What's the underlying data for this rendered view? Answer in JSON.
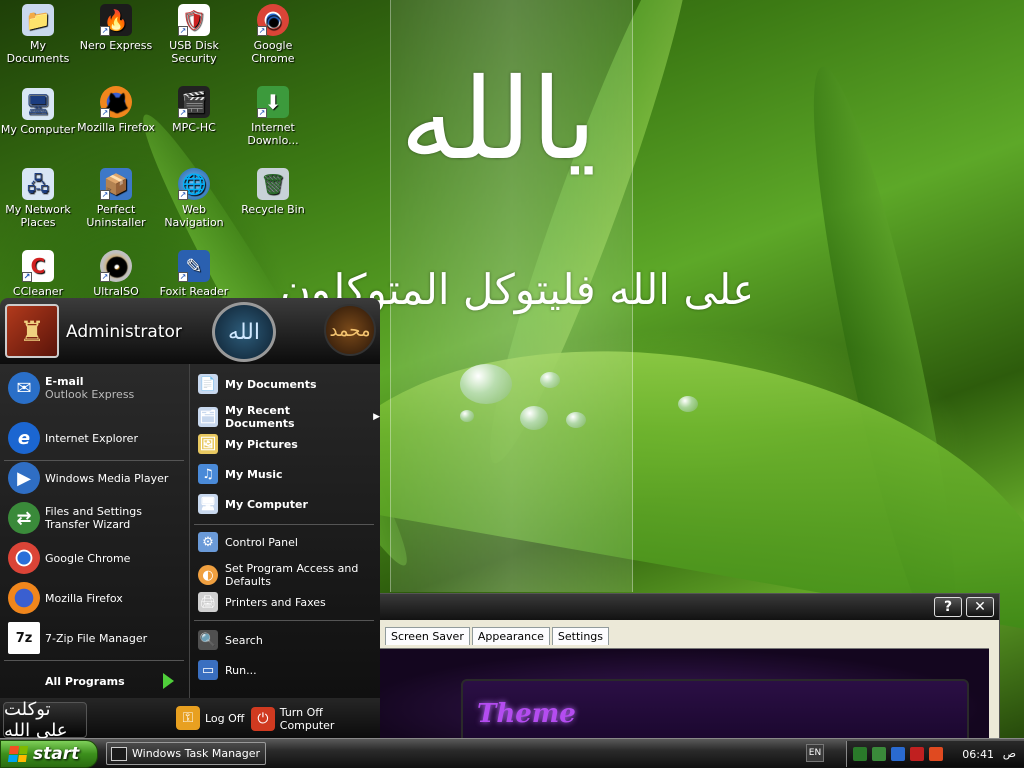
{
  "desktop": {
    "icons": [
      {
        "label": "My Documents",
        "glyph": "📁"
      },
      {
        "label": "Nero Express",
        "glyph": "🔥"
      },
      {
        "label": "USB Disk Security",
        "glyph": "🛡"
      },
      {
        "label": "Google Chrome",
        "glyph": "◉"
      },
      {
        "label": "My Computer",
        "glyph": "🖥"
      },
      {
        "label": "Mozilla Firefox",
        "glyph": "🦊"
      },
      {
        "label": "MPC-HC",
        "glyph": "🎬"
      },
      {
        "label": "Internet Downlo...",
        "glyph": "⬇"
      },
      {
        "label": "My Network Places",
        "glyph": "🖧"
      },
      {
        "label": "Perfect Uninstaller",
        "glyph": "📦"
      },
      {
        "label": "Web Navigation",
        "glyph": "🌐"
      },
      {
        "label": "Recycle Bin",
        "glyph": "🗑"
      },
      {
        "label": "CCleaner",
        "glyph": "C"
      },
      {
        "label": "UltraISO",
        "glyph": "💿"
      },
      {
        "label": "Foxit Reader",
        "glyph": "✎"
      }
    ]
  },
  "wallpaper": {
    "line1": "يالله",
    "line2": "وعلى الله فليتوكل المتوكلون"
  },
  "dialog": {
    "tabs": [
      "Screen Saver",
      "Appearance",
      "Settings"
    ],
    "help_label": "?",
    "close_label": "✕",
    "preview_text": "Theme"
  },
  "start_menu": {
    "username": "Administrator",
    "medallion": "الله",
    "medallion2": "محمد",
    "pinned": [
      {
        "title": "E-mail",
        "subtitle": "Outlook Express",
        "glyph": "✉",
        "color": "#2a6fc8"
      },
      {
        "title": "Internet Explorer",
        "glyph": "e",
        "color": "#1b66d1"
      }
    ],
    "recent": [
      {
        "title": "Windows Media Player",
        "glyph": "▶",
        "color": "#2f6ec4"
      },
      {
        "title": "Files and Settings Transfer Wizard",
        "glyph": "⇄",
        "color": "#3a8a3a"
      },
      {
        "title": "Google Chrome",
        "glyph": "◉",
        "color": "#d64032"
      },
      {
        "title": "Mozilla Firefox",
        "glyph": "🦊",
        "color": "#e06a18"
      },
      {
        "title": "7-Zip File Manager",
        "glyph": "7z",
        "color": "#111111"
      }
    ],
    "all_programs": "All Programs",
    "right_bold": [
      {
        "title": "My Documents",
        "glyph": "📄"
      },
      {
        "title": "My Recent Documents",
        "glyph": "🗂",
        "submenu": true
      },
      {
        "title": "My Pictures",
        "glyph": "🖼"
      },
      {
        "title": "My Music",
        "glyph": "♫"
      },
      {
        "title": "My Computer",
        "glyph": "🖥"
      }
    ],
    "right_plain": [
      {
        "title": "Control Panel",
        "glyph": "⚙"
      },
      {
        "title": "Set Program Access and Defaults",
        "glyph": "◐"
      },
      {
        "title": "Printers and Faxes",
        "glyph": "🖨"
      },
      {
        "title": "Search",
        "glyph": "🔍"
      },
      {
        "title": "Run...",
        "glyph": "▭"
      }
    ],
    "logoff": "Log Off",
    "turnoff": "Turn Off Computer",
    "calligraphy_button": "توكلت على الله"
  },
  "taskbar": {
    "start_label": "start",
    "task_button": "Windows Task Manager",
    "language": "EN",
    "clock": "06:41",
    "ampm": "ص",
    "tray_icons": [
      "network-icon",
      "display-icon",
      "sync-icon",
      "security-icon",
      "shield-icon"
    ]
  }
}
